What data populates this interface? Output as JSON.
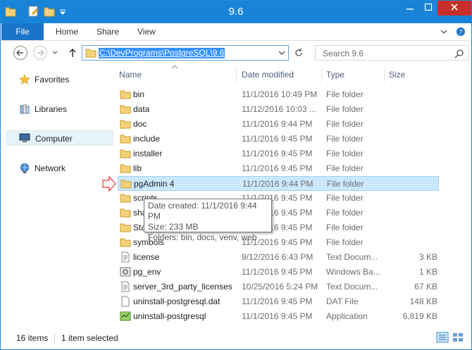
{
  "window": {
    "title": "9.6"
  },
  "ribbon": {
    "tabs": [
      {
        "label": "File"
      },
      {
        "label": "Home"
      },
      {
        "label": "Share"
      },
      {
        "label": "View"
      }
    ]
  },
  "address": {
    "path": "C:\\DevPrograms\\PostgreSQL\\9.6"
  },
  "search": {
    "placeholder": "Search 9.6"
  },
  "nav": {
    "items": [
      {
        "label": "Favorites",
        "icon": "star-icon"
      },
      {
        "label": "Libraries",
        "icon": "libraries-icon"
      },
      {
        "label": "Computer",
        "icon": "computer-icon"
      },
      {
        "label": "Network",
        "icon": "network-icon"
      }
    ]
  },
  "columns": {
    "name": "Name",
    "date": "Date modified",
    "type": "Type",
    "size": "Size"
  },
  "files": [
    {
      "name": "bin",
      "date": "11/1/2016 10:49 PM",
      "type": "File folder",
      "size": "",
      "icon": "folder-icon"
    },
    {
      "name": "data",
      "date": "11/12/2016 10:03 ...",
      "type": "File folder",
      "size": "",
      "icon": "folder-icon"
    },
    {
      "name": "doc",
      "date": "11/1/2016 9:44 PM",
      "type": "File folder",
      "size": "",
      "icon": "folder-icon"
    },
    {
      "name": "include",
      "date": "11/1/2016 9:45 PM",
      "type": "File folder",
      "size": "",
      "icon": "folder-icon"
    },
    {
      "name": "installer",
      "date": "11/1/2016 9:45 PM",
      "type": "File folder",
      "size": "",
      "icon": "folder-icon"
    },
    {
      "name": "lib",
      "date": "11/1/2016 9:45 PM",
      "type": "File folder",
      "size": "",
      "icon": "folder-icon"
    },
    {
      "name": "pgAdmin 4",
      "date": "11/1/2016 9:44 PM",
      "type": "File folder",
      "size": "",
      "icon": "folder-icon"
    },
    {
      "name": "scripts",
      "date": "11/1/2016 9:45 PM",
      "type": "File folder",
      "size": "",
      "icon": "folder-icon"
    },
    {
      "name": "share",
      "date": "11/1/2016 9:45 PM",
      "type": "File folder",
      "size": "",
      "icon": "folder-icon"
    },
    {
      "name": "StackBuilder",
      "date": "11/1/2016 9:45 PM",
      "type": "File folder",
      "size": "",
      "icon": "folder-icon"
    },
    {
      "name": "symbols",
      "date": "11/1/2016 9:45 PM",
      "type": "File folder",
      "size": "",
      "icon": "folder-icon"
    },
    {
      "name": "license",
      "date": "9/12/2016 6:43 PM",
      "type": "Text Docum...",
      "size": "3 KB",
      "icon": "text-file-icon"
    },
    {
      "name": "pg_env",
      "date": "11/1/2016 9:45 PM",
      "type": "Windows Ba...",
      "size": "1 KB",
      "icon": "batch-file-icon"
    },
    {
      "name": "server_3rd_party_licenses",
      "date": "10/25/2016 5:24 PM",
      "type": "Text Docum...",
      "size": "67 KB",
      "icon": "text-file-icon"
    },
    {
      "name": "uninstall-postgresql.dat",
      "date": "11/1/2016 9:45 PM",
      "type": "DAT File",
      "size": "148 KB",
      "icon": "dat-file-icon"
    },
    {
      "name": "uninstall-postgresql",
      "date": "11/1/2016 9:45 PM",
      "type": "Application",
      "size": "6,819 KB",
      "icon": "application-icon"
    }
  ],
  "selected_index": 6,
  "tooltip": {
    "created": "Date created: 11/1/2016 9:44 PM",
    "size": "Size: 233 MB",
    "folders": "Folders: bin, docs, venv, web"
  },
  "status": {
    "items": "16 items",
    "selected": "1 item selected"
  },
  "colors": {
    "titlebar": "#1984d7",
    "file_tab": "#1a75c8",
    "selection": "#cce8ff",
    "close": "#c7302a"
  }
}
